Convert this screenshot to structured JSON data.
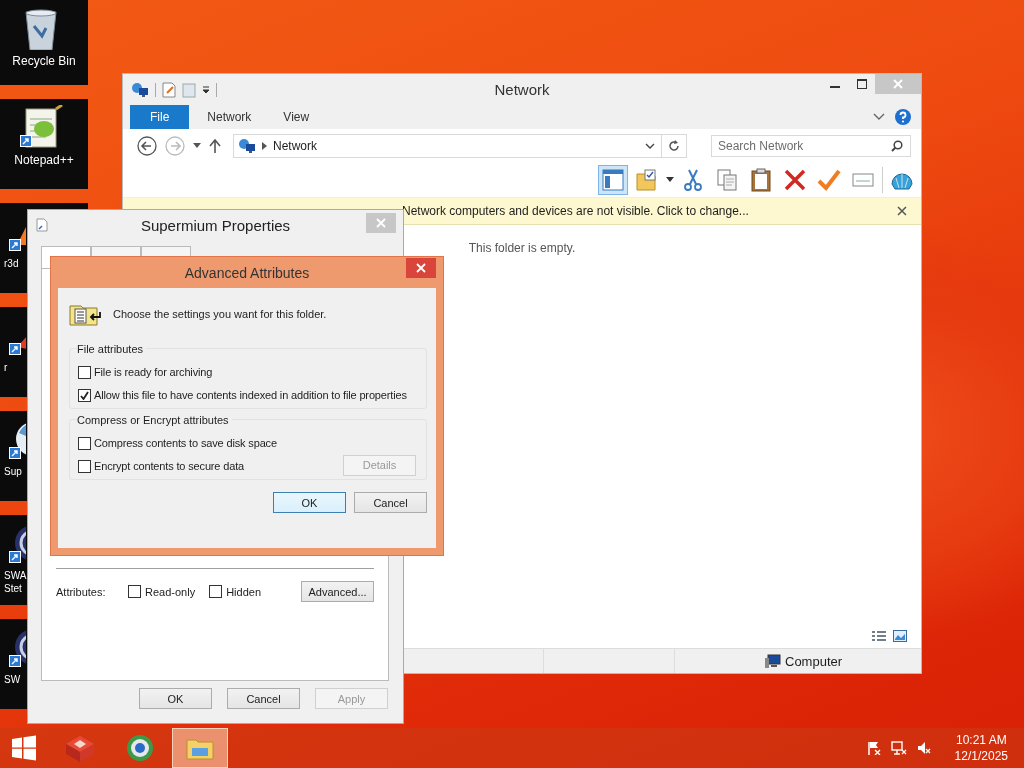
{
  "desktop_icons": [
    {
      "label": "Recycle Bin",
      "kind": "recycle",
      "partial": false
    },
    {
      "label": "Notepad++",
      "kind": "notepad",
      "partial": false
    },
    {
      "label": "r3d",
      "kind": "cone",
      "partial": true
    },
    {
      "label": "r",
      "kind": "arrow",
      "partial": true
    },
    {
      "label": "Sup",
      "kind": "globe",
      "partial": true
    },
    {
      "label": "SWA\nStet",
      "kind": "disc",
      "partial": true
    },
    {
      "label": "SW",
      "kind": "disc",
      "partial": true
    }
  ],
  "explorer": {
    "title": "Network",
    "ribbon_tabs": [
      {
        "label": "File",
        "kind": "file"
      },
      {
        "label": "Network",
        "kind": "tab"
      },
      {
        "label": "View",
        "kind": "tab"
      }
    ],
    "address": "Network",
    "search": {
      "placeholder": "Search Network"
    },
    "toolbar": [
      {
        "kind": "pane",
        "selected": true
      },
      {
        "kind": "folder",
        "selected": false
      },
      {
        "kind": "cut",
        "selected": false
      },
      {
        "kind": "copy",
        "selected": false
      },
      {
        "kind": "paste",
        "selected": false
      },
      {
        "kind": "delete",
        "selected": false
      },
      {
        "kind": "check",
        "selected": false
      },
      {
        "kind": "rename",
        "selected": false
      },
      {
        "kind": "shell",
        "selected": false
      }
    ],
    "info_bar": "Network computers and devices are not visible. Click to change...",
    "empty_message": "This folder is empty.",
    "status_bar": {
      "location": "Computer"
    }
  },
  "properties": {
    "title": "Supermium Properties",
    "tabs": [
      {
        "selected": true
      },
      {
        "selected": false
      },
      {
        "selected": false
      }
    ],
    "attributes_label": "Attributes:",
    "options": [
      {
        "label": "Read-only",
        "checked": false
      },
      {
        "label": "Hidden",
        "checked": false
      }
    ],
    "advanced_button": "Advanced...",
    "buttons": [
      {
        "label": "OK",
        "disabled": false
      },
      {
        "label": "Cancel",
        "disabled": false
      },
      {
        "label": "Apply",
        "disabled": true
      }
    ]
  },
  "advanced_dialog": {
    "title": "Advanced Attributes",
    "prompt": "Choose the settings you want for this folder.",
    "groups": [
      {
        "title": "File attributes",
        "options": [
          {
            "label": "File is ready for archiving",
            "checked": false
          },
          {
            "label": "Allow this file to have contents indexed in addition to file properties",
            "checked": true
          }
        ]
      },
      {
        "title": "Compress or Encrypt attributes",
        "options": [
          {
            "label": "Compress contents to save disk space",
            "checked": false
          },
          {
            "label": "Encrypt contents to secure data",
            "checked": false
          }
        ],
        "button": {
          "label": "Details",
          "disabled": true
        }
      }
    ],
    "buttons": [
      {
        "label": "OK",
        "default": true
      },
      {
        "label": "Cancel",
        "default": false
      }
    ]
  },
  "taskbar": {
    "apps": [
      {
        "kind": "cube",
        "active": false
      },
      {
        "kind": "browser",
        "active": false
      },
      {
        "kind": "explorer",
        "active": true
      }
    ],
    "time": "10:21 AM",
    "date": "12/1/2025"
  }
}
